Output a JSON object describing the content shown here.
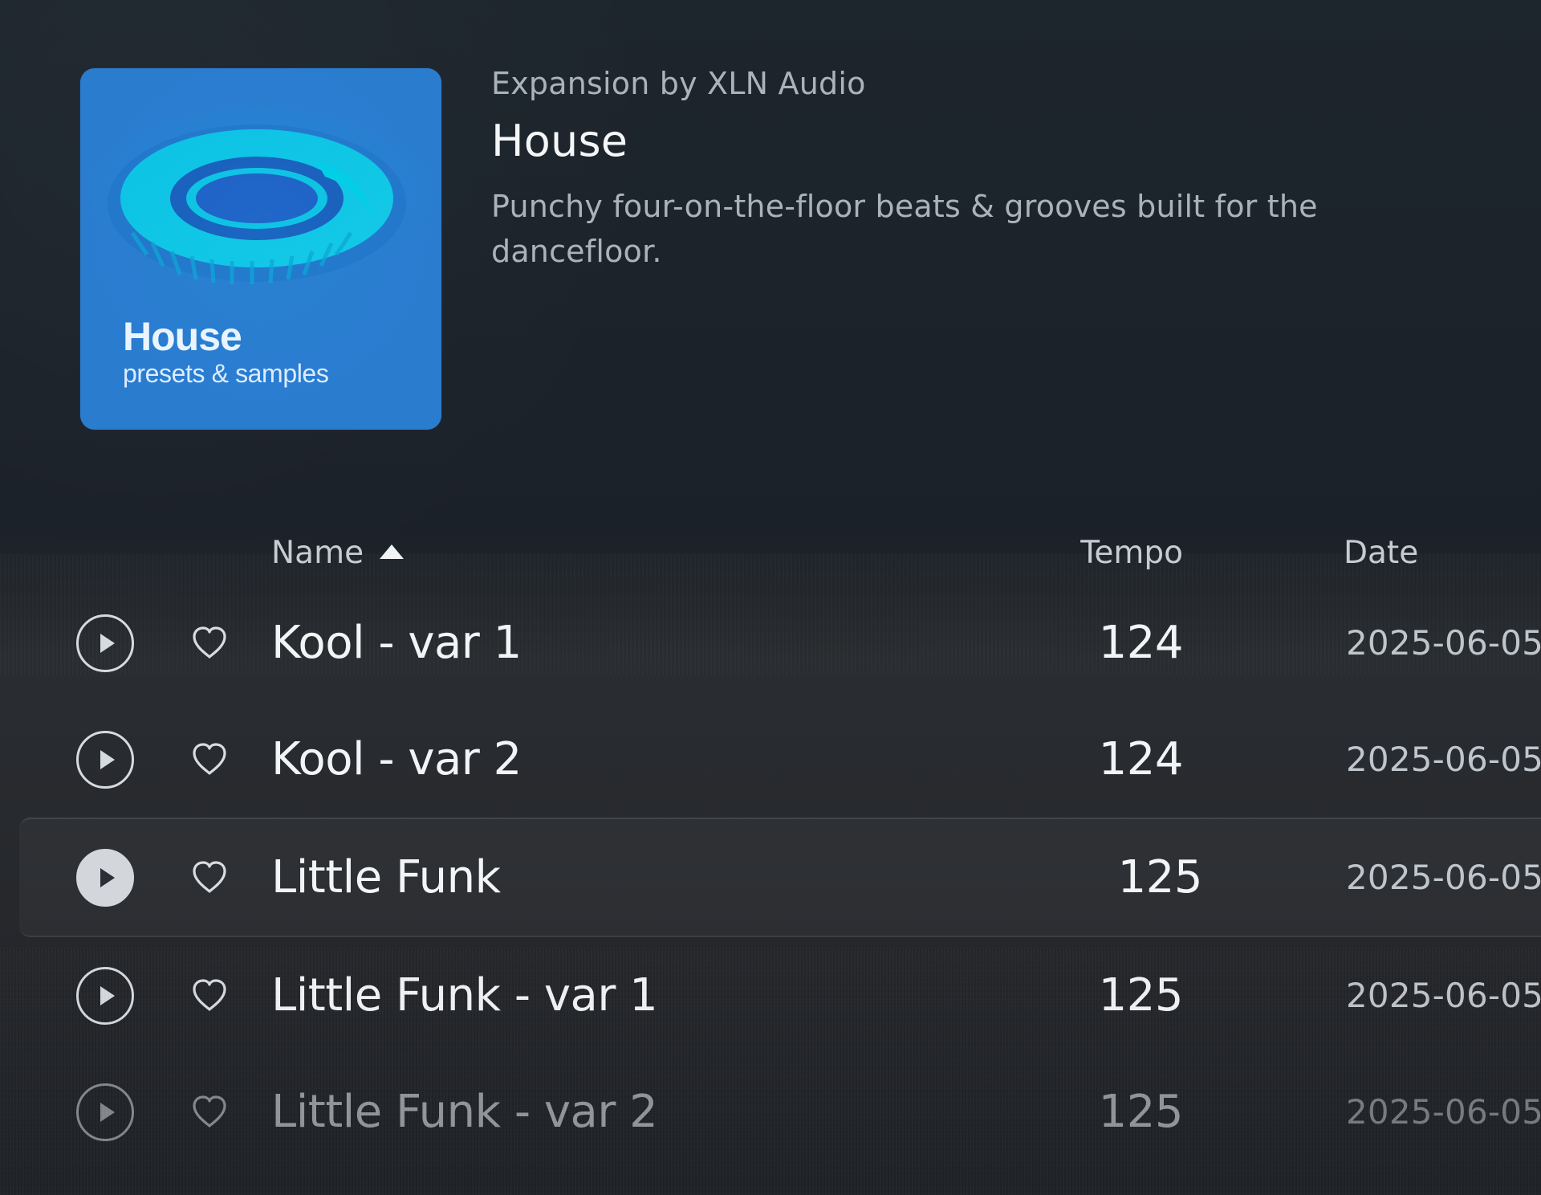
{
  "pack": {
    "meta_line": "Expansion by XLN Audio",
    "title": "House",
    "description": "Punchy four-on-the-floor beats & grooves built for the dancefloor."
  },
  "artwork": {
    "title": "House",
    "subtitle": "presets & samples",
    "colors": {
      "background": "#1f86d8",
      "ring_outer": "#17b9de",
      "ring_inner": "#0ad0e3",
      "shadow": "#1749a6"
    }
  },
  "table": {
    "headers": {
      "name": "Name",
      "tempo": "Tempo",
      "date": "Date"
    },
    "sort": {
      "column": "Name",
      "direction": "ascending"
    },
    "rows": [
      {
        "name": "Kool - var 1",
        "tempo": "124",
        "date": "2025-06-05",
        "state": "normal"
      },
      {
        "name": "Kool - var 2",
        "tempo": "124",
        "date": "2025-06-05",
        "state": "normal"
      },
      {
        "name": "Little Funk",
        "tempo": "125",
        "date": "2025-06-05",
        "state": "selected"
      },
      {
        "name": "Little Funk - var 1",
        "tempo": "125",
        "date": "2025-06-05",
        "state": "normal"
      },
      {
        "name": "Little Funk - var 2",
        "tempo": "125",
        "date": "2025-06-05",
        "state": "dim"
      }
    ]
  },
  "icons": {
    "sort": "sort-up-icon",
    "play": "play-icon",
    "favorite": "heart-outline-icon"
  },
  "colors": {
    "background": "#1d252d",
    "text_primary": "#f2f4f6",
    "text_secondary": "#aab3bc",
    "selected_play": "#d3d7db"
  }
}
